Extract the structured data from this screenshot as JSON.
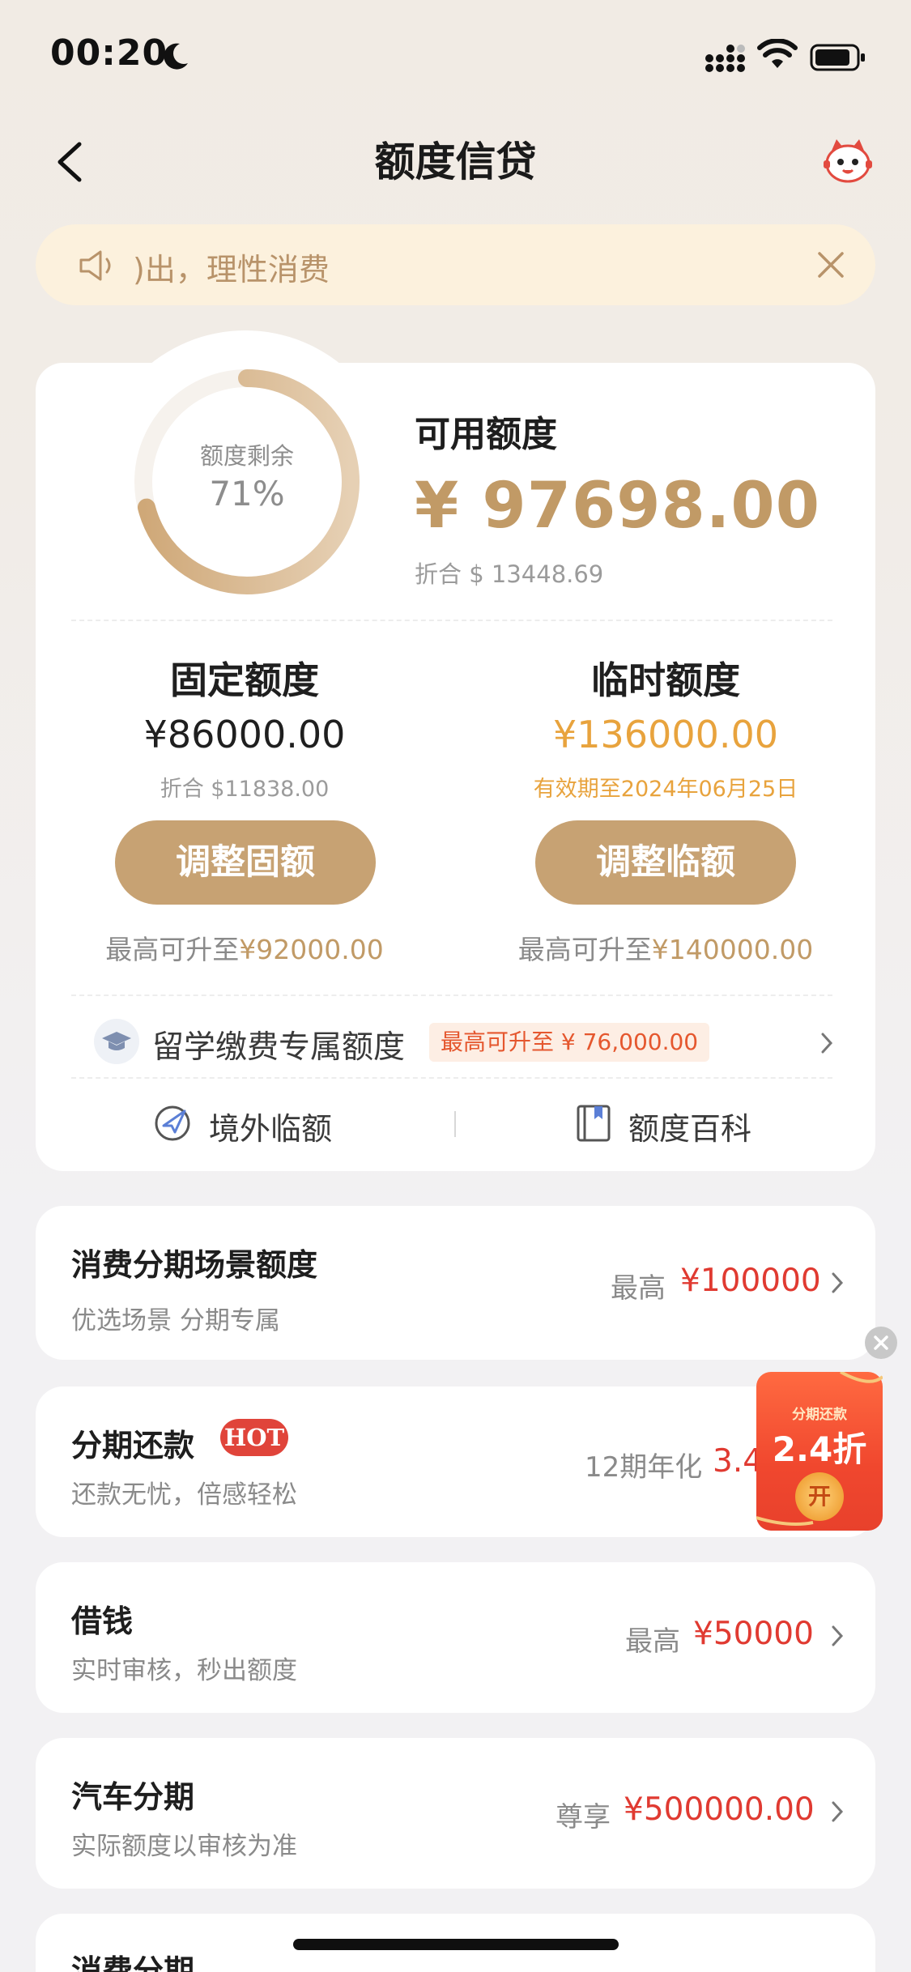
{
  "status_bar": {
    "time": "00:20"
  },
  "header": {
    "title": "额度信贷"
  },
  "notice": {
    "text": ")出，理性消费"
  },
  "credit": {
    "ring_label": "额度剩余",
    "ring_percent_text": "71%",
    "ring_fraction": 0.71,
    "available_label": "可用额度",
    "available_amount": "¥ 97698.00",
    "available_converted": "折合 $ 13448.69"
  },
  "fixed": {
    "title": "固定额度",
    "amount": "¥86000.00",
    "converted": "折合 $11838.00",
    "button": "调整固额",
    "max_prefix": "最高可升至",
    "max_value": "¥92000.00"
  },
  "temp": {
    "title": "临时额度",
    "amount": "¥136000.00",
    "validity": "有效期至2024年06月25日",
    "button": "调整临额",
    "max_prefix": "最高可升至",
    "max_value": "¥140000.00"
  },
  "study": {
    "label": "留学缴费专属额度",
    "tag": "最高可升至 ¥ 76,000.00"
  },
  "links": {
    "overseas": "境外临额",
    "wiki": "额度百科"
  },
  "list": [
    {
      "title": "消费分期场景额度",
      "sub": "优选场景 分期专属",
      "right_label": "最高",
      "right_value": "¥100000"
    },
    {
      "title": "分期还款",
      "badge": "HOT",
      "sub": "还款无忧，倍感轻松",
      "right_label": "12期年化",
      "right_value": "3.4"
    },
    {
      "title": "借钱",
      "sub": "实时审核，秒出额度",
      "right_label": "最高",
      "right_value": "¥50000"
    },
    {
      "title": "汽车分期",
      "sub": "实际额度以审核为准",
      "right_label": "尊享",
      "right_value": "¥500000.00"
    },
    {
      "title": "消费分期"
    }
  ],
  "promo": {
    "small": "分期还款",
    "big": "2.4折",
    "coin": "开"
  },
  "colors": {
    "gold": "#c19a66",
    "button": "#c7a273",
    "orange": "#e8a33d",
    "red": "#e03a31"
  }
}
